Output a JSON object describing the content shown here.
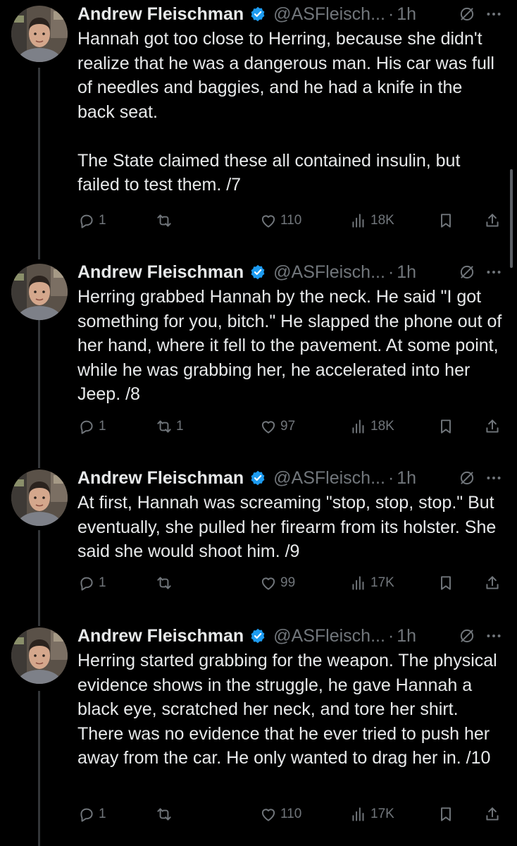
{
  "tweets": [
    {
      "name": "Andrew Fleischman",
      "handle": "@ASFleisch...",
      "separator": "·",
      "time": "1h",
      "text": "Hannah got too close to Herring, because she didn't realize that he was a dangerous man. His car was full of needles and baggies, and he had a knife in the back seat.\n\nThe State claimed these all contained insulin, but failed to test them. /7",
      "replies": "1",
      "retweets": "",
      "likes": "110",
      "views": "18K"
    },
    {
      "name": "Andrew Fleischman",
      "handle": "@ASFleisch...",
      "separator": "·",
      "time": "1h",
      "text": "Herring grabbed Hannah by the neck. He said \"I got something for you, bitch.\" He slapped the phone out of her hand, where it fell to the pavement. At some point, while he was grabbing her, he accelerated into her Jeep. /8",
      "replies": "1",
      "retweets": "1",
      "likes": "97",
      "views": "18K"
    },
    {
      "name": "Andrew Fleischman",
      "handle": "@ASFleisch...",
      "separator": "·",
      "time": "1h",
      "text": "At first, Hannah was screaming \"stop, stop, stop.\" But eventually, she pulled her firearm from its holster. She said she would shoot him. /9",
      "replies": "1",
      "retweets": "",
      "likes": "99",
      "views": "17K"
    },
    {
      "name": "Andrew Fleischman",
      "handle": "@ASFleisch...",
      "separator": "·",
      "time": "1h",
      "text": "Herring started grabbing for the weapon. The physical evidence shows in the struggle, he gave Hannah a black eye, scratched her neck, and tore her shirt. There was no evidence that he ever tried to push her away from the car. He only wanted to drag her in. /10",
      "replies": "1",
      "retweets": "",
      "likes": "110",
      "views": "17K"
    }
  ],
  "icons": {
    "verified": "verified-badge-icon",
    "grok": "grok-icon",
    "more": "more-icon",
    "reply": "reply-icon",
    "retweet": "retweet-icon",
    "like": "heart-icon",
    "views": "views-icon",
    "bookmark": "bookmark-icon",
    "share": "share-icon"
  },
  "colors": {
    "background": "#000000",
    "text": "#e7e9ea",
    "muted": "#71767b",
    "verified": "#1d9bf0"
  }
}
